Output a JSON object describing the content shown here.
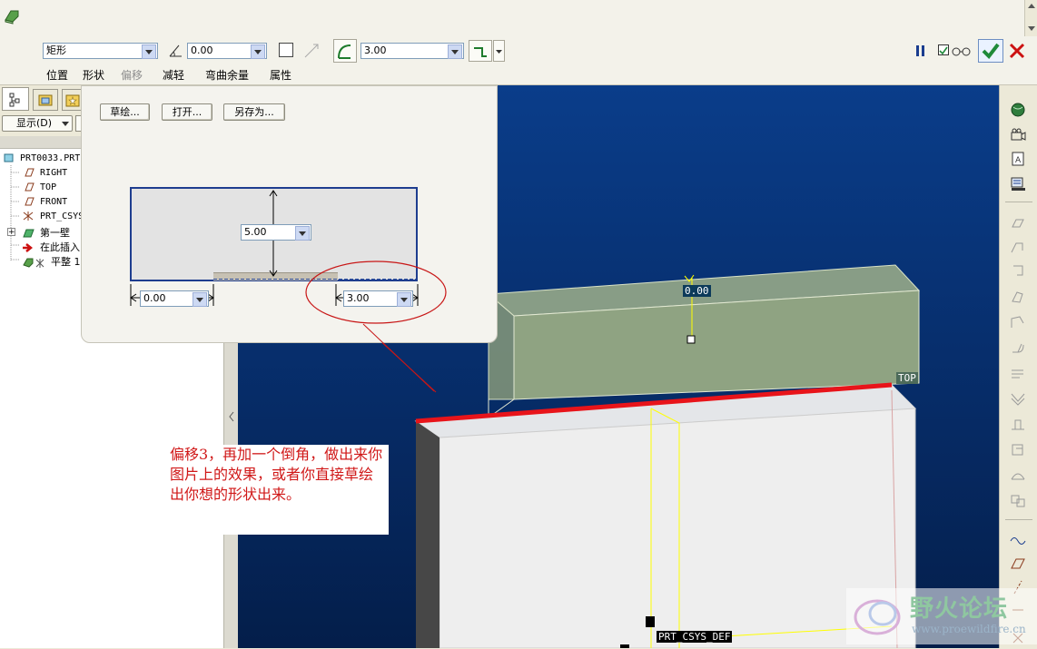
{
  "dashboard": {
    "shape_type": "矩形",
    "offset_value": "0.00",
    "length_value": "3.00",
    "tabs": [
      "位置",
      "形状",
      "偏移",
      "减轻",
      "弯曲余量",
      "属性"
    ]
  },
  "left_panel": {
    "display_button": "显示(D)"
  },
  "model_tree": {
    "items": [
      "PRT0033.PRT",
      "RIGHT",
      "TOP",
      "FRONT",
      "PRT_CSYS",
      "第一壁",
      "在此插入",
      "平整 1"
    ]
  },
  "shape_panel": {
    "sketch_button": "草绘...",
    "open_button": "打开...",
    "saveas_button": "另存为...",
    "height_value": "5.00",
    "left_offset_value": "0.00",
    "right_offset_value": "3.00"
  },
  "viewport": {
    "dim_label": "0.00",
    "top_label": "TOP",
    "csys_label": "PRT_CSYS_DEF",
    "csys_short": "PRT"
  },
  "annotation": {
    "text": "偏移3，再加一个倒角，做出来你图片上的效果，或者你直接草绘出你想的形状出来。"
  },
  "watermark": {
    "title": "野火论坛",
    "url": "www.proewildfire.cn"
  },
  "colors": {
    "accent_red": "#e8141a",
    "viewport_blue": "#072f6e",
    "annotation_red": "#d01818",
    "confirm_green": "#1f8a3a"
  }
}
